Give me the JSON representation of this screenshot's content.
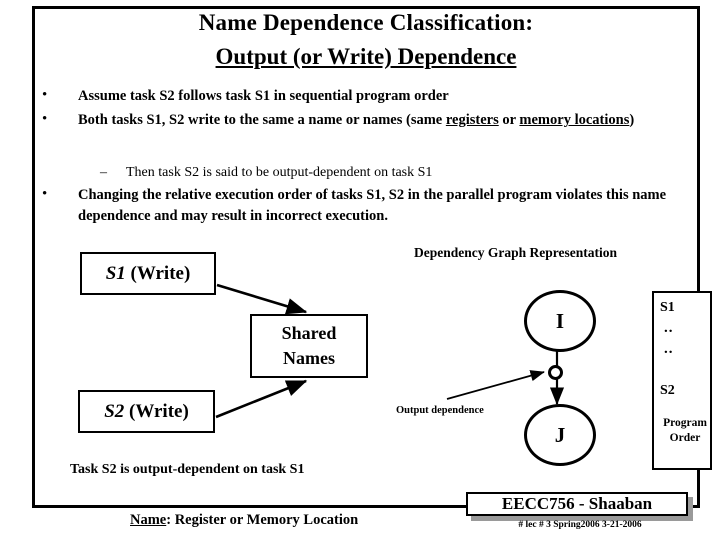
{
  "slide": {
    "title_line1": "Name Dependence Classification:",
    "title_line2": "Output (or Write) Dependence",
    "bullets": [
      {
        "mark": "•",
        "text": "Assume  task S2 follows task S1 in sequential program order"
      },
      {
        "mark": "•",
        "text_part1": "Both tasks S1, S2  write to the same  a name or names (same ",
        "underlined1": "registers",
        "text_part2": " or ",
        "underlined2": "memory locations",
        "text_part3": ")"
      },
      {
        "mark": "–",
        "text": "Then task S2 is said to be output-dependent on task S1"
      },
      {
        "mark": "•",
        "text": "Changing the relative execution order of tasks S1, S2  in the parallel program violates this name dependence and may result in  incorrect execution."
      }
    ],
    "conclusion": "Task S2 is output-dependent on task S1",
    "name_definition_label": "Name",
    "name_definition_rest": ": Register  or  Memory Location"
  },
  "left_diagram": {
    "box_s1": {
      "italic": "S1",
      "roman": " (Write)"
    },
    "box_s2": {
      "italic": "S2",
      "roman": " (Write)"
    },
    "box_shared_line1": "Shared",
    "box_shared_line2": "Names"
  },
  "dependency_graph": {
    "title": "Dependency Graph Representation",
    "node_i": "I",
    "node_j": "J",
    "edge_marker": "O",
    "edge_label": "Output dependence"
  },
  "program_order": {
    "first": "S1",
    "dots_1": "..",
    "dots_2": "..",
    "last": "S2",
    "caption_line1": "Program",
    "caption_line2": "Order"
  },
  "footer": {
    "badge": "EECC756 - Shaaban",
    "meta": "#  lec # 3    Spring2006   3-21-2006"
  },
  "colors": {
    "ink": "#000000",
    "paper": "#ffffff",
    "shadow": "#9a9a9a"
  }
}
